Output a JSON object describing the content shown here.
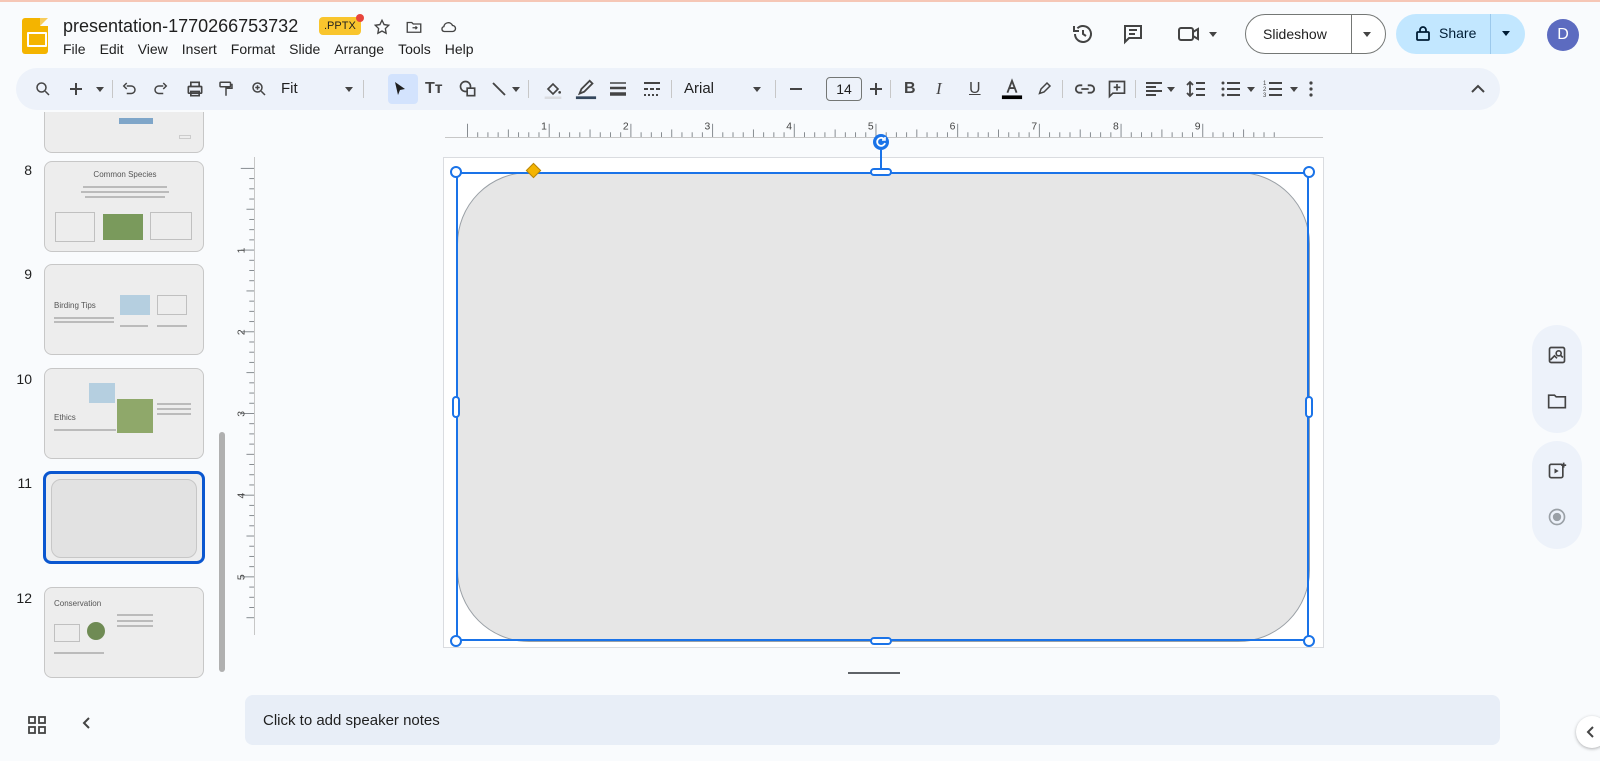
{
  "header": {
    "doc_title": "presentation-1770266753732",
    "file_badge": ".PPTX",
    "menu": [
      "File",
      "Edit",
      "View",
      "Insert",
      "Format",
      "Slide",
      "Arrange",
      "Tools",
      "Help"
    ],
    "slideshow_label": "Slideshow",
    "share_label": "Share",
    "avatar_initial": "D"
  },
  "toolbar": {
    "zoom_label": "Fit",
    "font_name": "Arial",
    "font_size": "14",
    "accent_color": "#0b57d0"
  },
  "ruler": {
    "horizontal_ticks": [
      "1",
      "2",
      "3",
      "4",
      "5",
      "6",
      "7",
      "8",
      "9"
    ],
    "vertical_ticks": [
      "1",
      "2",
      "3",
      "4",
      "5"
    ]
  },
  "filmstrip": {
    "slides": [
      {
        "number": "8",
        "title": "Common Species"
      },
      {
        "number": "9",
        "title": "Birding Tips"
      },
      {
        "number": "10",
        "title": "Ethics"
      },
      {
        "number": "11",
        "title": ""
      },
      {
        "number": "12",
        "title": "Conservation"
      }
    ],
    "selected_slide": "11"
  },
  "notes": {
    "placeholder": "Click to add speaker notes"
  }
}
